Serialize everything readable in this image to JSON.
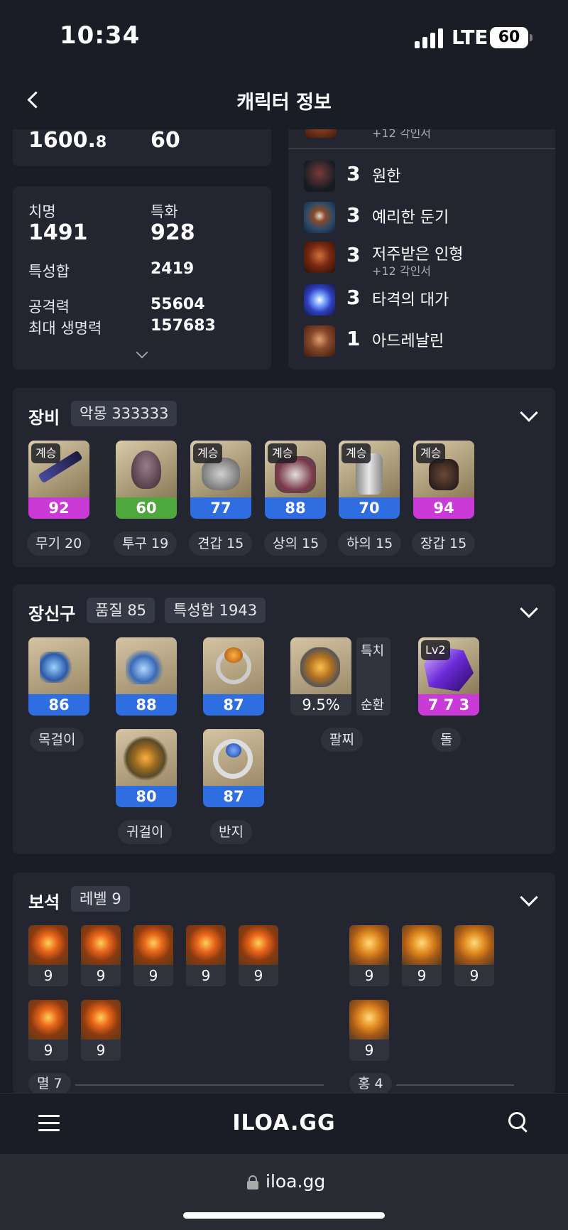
{
  "status": {
    "time": "10:34",
    "network": "LTE",
    "battery": "60"
  },
  "header": {
    "title": "캐릭터 정보"
  },
  "stats_top": {
    "item_level": "1600.",
    "item_level_decimal": "8",
    "level": "60"
  },
  "stats": {
    "crit_label": "치명",
    "crit": "1491",
    "spec_label": "특화",
    "spec": "928",
    "total_label": "특성합",
    "total": "2419",
    "attack_label": "공격력",
    "attack": "55604",
    "hp_label": "최대 생명력",
    "hp": "157683"
  },
  "engravings": {
    "partial_sub": "+12 각인서",
    "items": [
      {
        "level": "3",
        "name": "원한",
        "sub": ""
      },
      {
        "level": "3",
        "name": "예리한 둔기",
        "sub": ""
      },
      {
        "level": "3",
        "name": "저주받은 인형",
        "sub": "+12 각인서"
      },
      {
        "level": "3",
        "name": "타격의 대가",
        "sub": ""
      },
      {
        "level": "1",
        "name": "아드레날린",
        "sub": ""
      }
    ]
  },
  "equipment": {
    "title": "장비",
    "set_pill": "악몽 333333",
    "items": [
      {
        "tag": "계승",
        "quality": "92",
        "label": "무기 20",
        "color": "#c93ad6"
      },
      {
        "tag": "",
        "quality": "60",
        "label": "투구 19",
        "color": "#4fa83c"
      },
      {
        "tag": "계승",
        "quality": "77",
        "label": "견갑 15",
        "color": "#2f6ee0"
      },
      {
        "tag": "계승",
        "quality": "88",
        "label": "상의 15",
        "color": "#2f6ee0"
      },
      {
        "tag": "계승",
        "quality": "70",
        "label": "하의 15",
        "color": "#2f6ee0"
      },
      {
        "tag": "계승",
        "quality": "94",
        "label": "장갑 15",
        "color": "#c93ad6"
      }
    ]
  },
  "accessories": {
    "title": "장신구",
    "quality_pill": "품질 85",
    "total_pill": "특성합 1943",
    "necklace": {
      "quality": "86",
      "label": "목걸이"
    },
    "earring1": {
      "quality": "88"
    },
    "ring1": {
      "quality": "87"
    },
    "bracelet": {
      "value": "9.5%",
      "label": "팔찌",
      "side_top": "특치",
      "side_bottom": "순환"
    },
    "stone": {
      "tag": "Lv2",
      "value": "7 7 3",
      "label": "돌"
    },
    "earring2": {
      "quality": "80",
      "label": "귀걸이"
    },
    "ring2": {
      "quality": "87",
      "label": "반지"
    }
  },
  "gems": {
    "title": "보석",
    "level_pill": "레벨 9",
    "red": [
      "9",
      "9",
      "9",
      "9",
      "9",
      "9",
      "9"
    ],
    "blue": [
      "9",
      "9",
      "9",
      "9"
    ],
    "red_label": "멸 7",
    "blue_label": "홍 4"
  },
  "bottom": {
    "logo": "ILOA.GG",
    "url": "iloa.gg"
  }
}
